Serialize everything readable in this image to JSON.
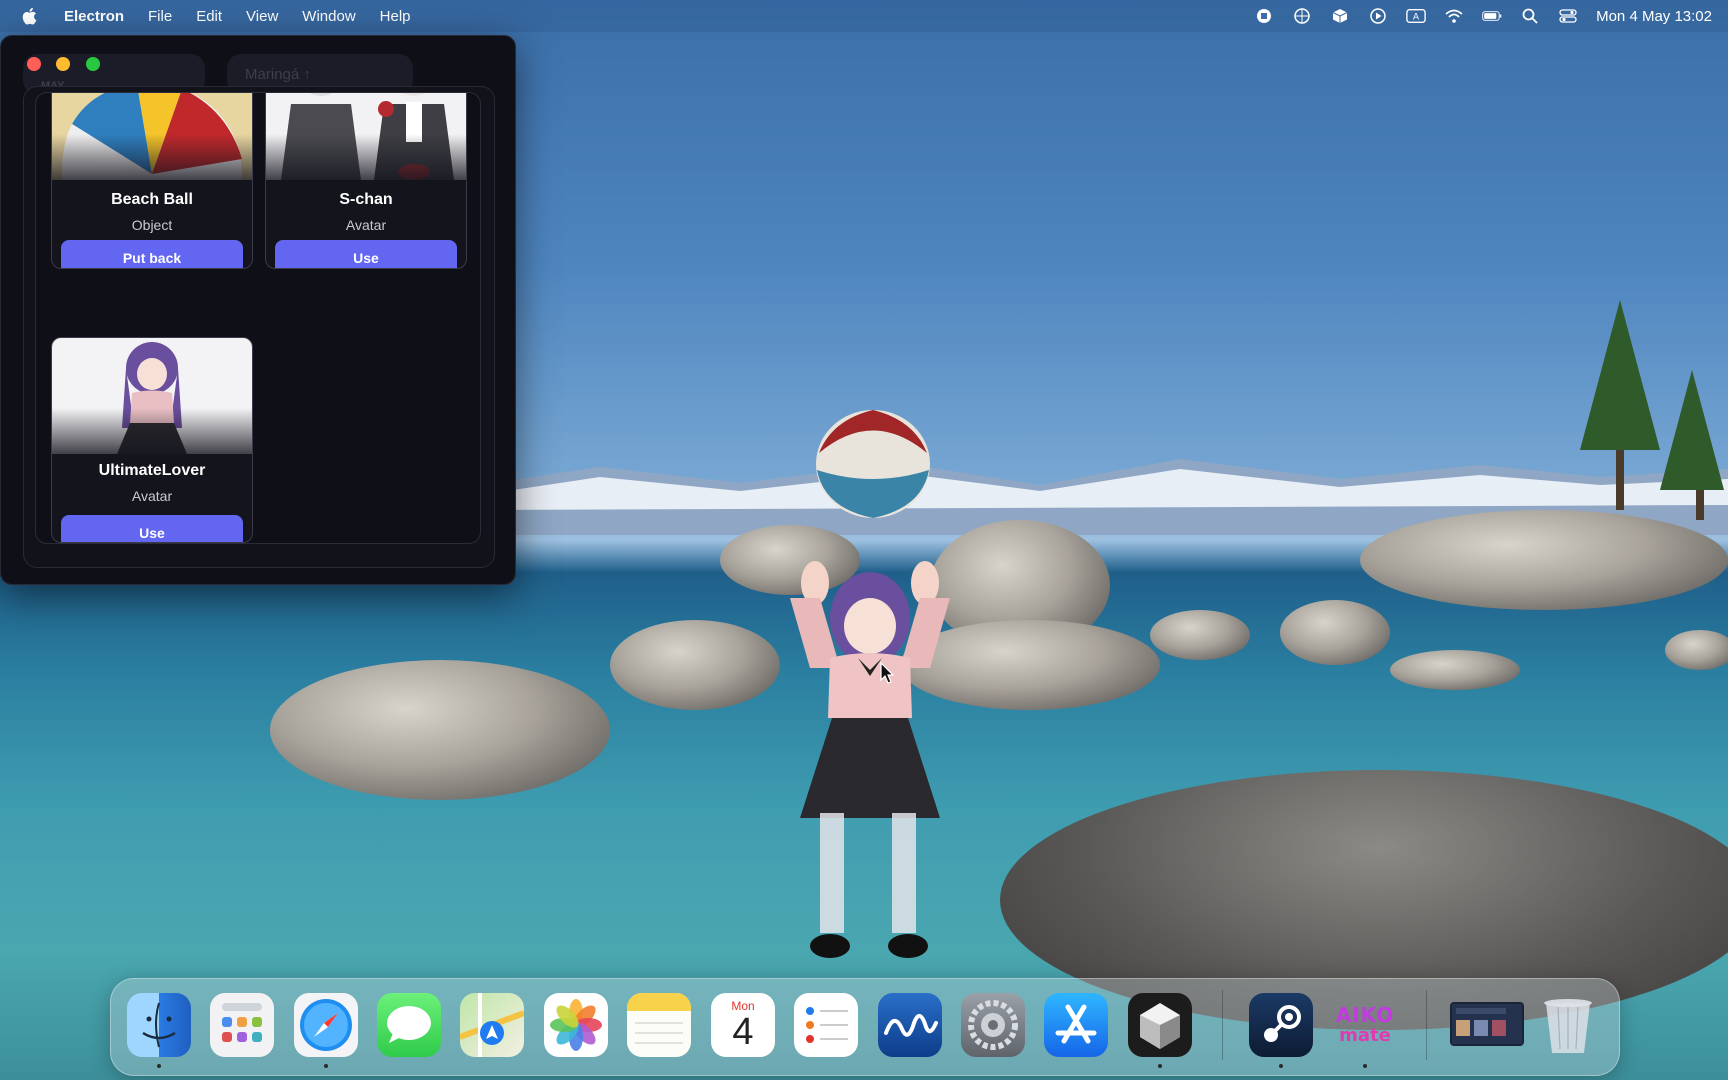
{
  "menubar": {
    "app_name": "Electron",
    "menus": [
      "File",
      "Edit",
      "View",
      "Window",
      "Help"
    ],
    "clock": "Mon 4 May  13:02"
  },
  "window": {
    "ghost_left": "MAY",
    "ghost_right": "Maringá ↑",
    "cards": [
      {
        "title": "Beach Ball",
        "type": "Object",
        "button": "Put back"
      },
      {
        "title": "S-chan",
        "type": "Avatar",
        "button": "Use"
      },
      {
        "title": "UltimateLover",
        "type": "Avatar",
        "button": "Use"
      }
    ]
  },
  "dock": {
    "calendar_day_name": "Mon",
    "calendar_day_num": "4",
    "aiko_line1": "AIKO",
    "aiko_line2": "mate"
  },
  "colors": {
    "accent_button": "#6366f1",
    "window_bg": "#0f0f17",
    "close": "#ff5f57",
    "minimize": "#febc2e",
    "maximize": "#28c840"
  }
}
